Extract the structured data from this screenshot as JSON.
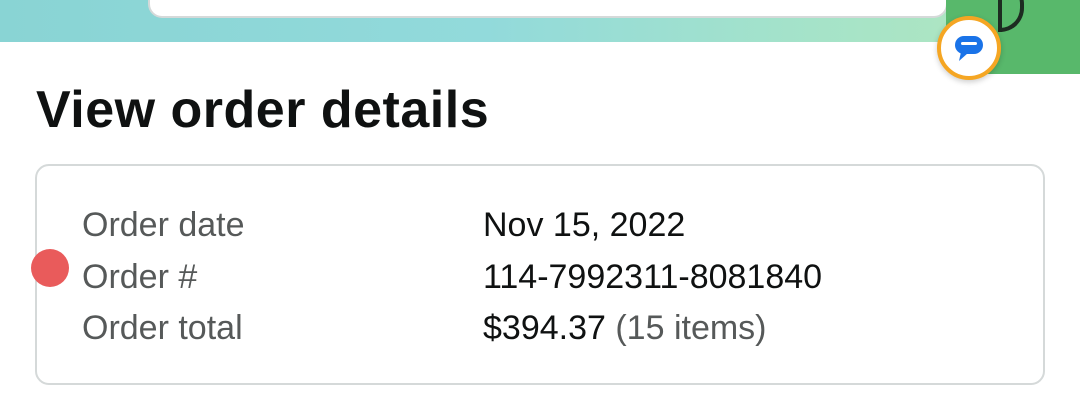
{
  "header": {
    "chat_icon_name": "chat-bubble-icon",
    "accent_color": "#f5a623",
    "action_color": "#58b86b"
  },
  "page": {
    "title": "View order details"
  },
  "order": {
    "rows": [
      {
        "label": "Order date",
        "value": "Nov 15, 2022",
        "sub": ""
      },
      {
        "label": "Order #",
        "value": "114-7992311-8081840",
        "sub": ""
      },
      {
        "label": "Order total",
        "value": "$394.37",
        "sub": "(15 items)"
      }
    ]
  },
  "touch_indicator": {
    "color": "#e95b5b"
  }
}
